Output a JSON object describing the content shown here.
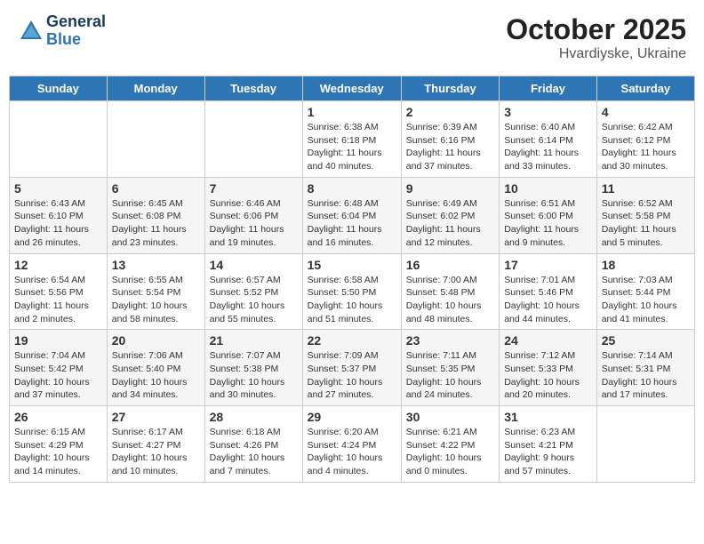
{
  "header": {
    "logo_line1": "General",
    "logo_line2": "Blue",
    "month": "October 2025",
    "location": "Hvardiyske, Ukraine"
  },
  "days_of_week": [
    "Sunday",
    "Monday",
    "Tuesday",
    "Wednesday",
    "Thursday",
    "Friday",
    "Saturday"
  ],
  "weeks": [
    [
      {
        "day": "",
        "info": ""
      },
      {
        "day": "",
        "info": ""
      },
      {
        "day": "",
        "info": ""
      },
      {
        "day": "1",
        "info": "Sunrise: 6:38 AM\nSunset: 6:18 PM\nDaylight: 11 hours\nand 40 minutes."
      },
      {
        "day": "2",
        "info": "Sunrise: 6:39 AM\nSunset: 6:16 PM\nDaylight: 11 hours\nand 37 minutes."
      },
      {
        "day": "3",
        "info": "Sunrise: 6:40 AM\nSunset: 6:14 PM\nDaylight: 11 hours\nand 33 minutes."
      },
      {
        "day": "4",
        "info": "Sunrise: 6:42 AM\nSunset: 6:12 PM\nDaylight: 11 hours\nand 30 minutes."
      }
    ],
    [
      {
        "day": "5",
        "info": "Sunrise: 6:43 AM\nSunset: 6:10 PM\nDaylight: 11 hours\nand 26 minutes."
      },
      {
        "day": "6",
        "info": "Sunrise: 6:45 AM\nSunset: 6:08 PM\nDaylight: 11 hours\nand 23 minutes."
      },
      {
        "day": "7",
        "info": "Sunrise: 6:46 AM\nSunset: 6:06 PM\nDaylight: 11 hours\nand 19 minutes."
      },
      {
        "day": "8",
        "info": "Sunrise: 6:48 AM\nSunset: 6:04 PM\nDaylight: 11 hours\nand 16 minutes."
      },
      {
        "day": "9",
        "info": "Sunrise: 6:49 AM\nSunset: 6:02 PM\nDaylight: 11 hours\nand 12 minutes."
      },
      {
        "day": "10",
        "info": "Sunrise: 6:51 AM\nSunset: 6:00 PM\nDaylight: 11 hours\nand 9 minutes."
      },
      {
        "day": "11",
        "info": "Sunrise: 6:52 AM\nSunset: 5:58 PM\nDaylight: 11 hours\nand 5 minutes."
      }
    ],
    [
      {
        "day": "12",
        "info": "Sunrise: 6:54 AM\nSunset: 5:56 PM\nDaylight: 11 hours\nand 2 minutes."
      },
      {
        "day": "13",
        "info": "Sunrise: 6:55 AM\nSunset: 5:54 PM\nDaylight: 10 hours\nand 58 minutes."
      },
      {
        "day": "14",
        "info": "Sunrise: 6:57 AM\nSunset: 5:52 PM\nDaylight: 10 hours\nand 55 minutes."
      },
      {
        "day": "15",
        "info": "Sunrise: 6:58 AM\nSunset: 5:50 PM\nDaylight: 10 hours\nand 51 minutes."
      },
      {
        "day": "16",
        "info": "Sunrise: 7:00 AM\nSunset: 5:48 PM\nDaylight: 10 hours\nand 48 minutes."
      },
      {
        "day": "17",
        "info": "Sunrise: 7:01 AM\nSunset: 5:46 PM\nDaylight: 10 hours\nand 44 minutes."
      },
      {
        "day": "18",
        "info": "Sunrise: 7:03 AM\nSunset: 5:44 PM\nDaylight: 10 hours\nand 41 minutes."
      }
    ],
    [
      {
        "day": "19",
        "info": "Sunrise: 7:04 AM\nSunset: 5:42 PM\nDaylight: 10 hours\nand 37 minutes."
      },
      {
        "day": "20",
        "info": "Sunrise: 7:06 AM\nSunset: 5:40 PM\nDaylight: 10 hours\nand 34 minutes."
      },
      {
        "day": "21",
        "info": "Sunrise: 7:07 AM\nSunset: 5:38 PM\nDaylight: 10 hours\nand 30 minutes."
      },
      {
        "day": "22",
        "info": "Sunrise: 7:09 AM\nSunset: 5:37 PM\nDaylight: 10 hours\nand 27 minutes."
      },
      {
        "day": "23",
        "info": "Sunrise: 7:11 AM\nSunset: 5:35 PM\nDaylight: 10 hours\nand 24 minutes."
      },
      {
        "day": "24",
        "info": "Sunrise: 7:12 AM\nSunset: 5:33 PM\nDaylight: 10 hours\nand 20 minutes."
      },
      {
        "day": "25",
        "info": "Sunrise: 7:14 AM\nSunset: 5:31 PM\nDaylight: 10 hours\nand 17 minutes."
      }
    ],
    [
      {
        "day": "26",
        "info": "Sunrise: 6:15 AM\nSunset: 4:29 PM\nDaylight: 10 hours\nand 14 minutes."
      },
      {
        "day": "27",
        "info": "Sunrise: 6:17 AM\nSunset: 4:27 PM\nDaylight: 10 hours\nand 10 minutes."
      },
      {
        "day": "28",
        "info": "Sunrise: 6:18 AM\nSunset: 4:26 PM\nDaylight: 10 hours\nand 7 minutes."
      },
      {
        "day": "29",
        "info": "Sunrise: 6:20 AM\nSunset: 4:24 PM\nDaylight: 10 hours\nand 4 minutes."
      },
      {
        "day": "30",
        "info": "Sunrise: 6:21 AM\nSunset: 4:22 PM\nDaylight: 10 hours\nand 0 minutes."
      },
      {
        "day": "31",
        "info": "Sunrise: 6:23 AM\nSunset: 4:21 PM\nDaylight: 9 hours\nand 57 minutes."
      },
      {
        "day": "",
        "info": ""
      }
    ]
  ]
}
